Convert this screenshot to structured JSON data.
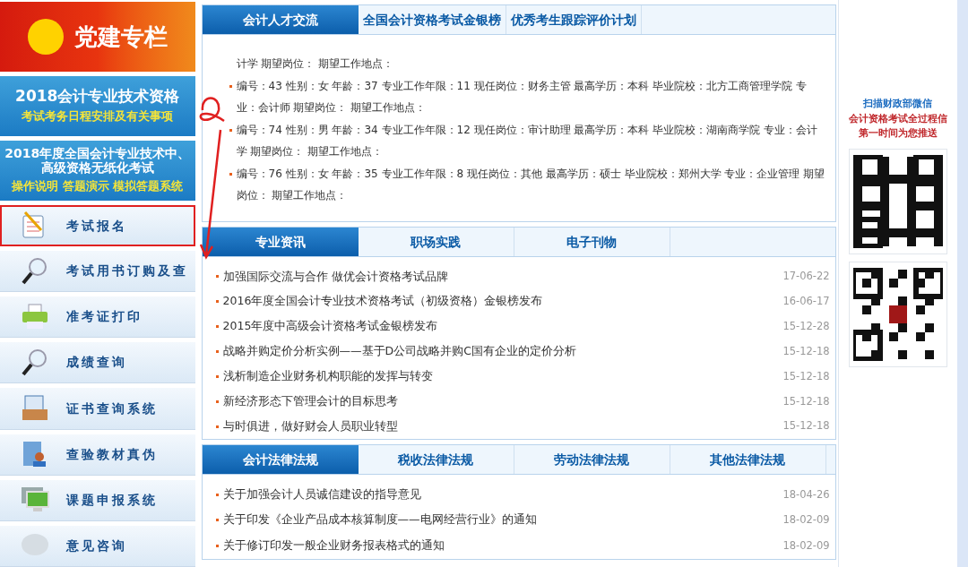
{
  "banners": [
    {
      "title": "党建专栏"
    },
    {
      "title": "2018会计专业技术资格",
      "subtitle": "考试考务日程安排及有关事项"
    },
    {
      "title": "2018年度全国会计专业技术中、高级资格无纸化考试",
      "subtitle": "操作说明 答题演示 模拟答题系统"
    }
  ],
  "menu": [
    {
      "label": "考试报名",
      "highlighted": true
    },
    {
      "label": "考试用书订购及查",
      "highlighted": false
    },
    {
      "label": "准考证打印",
      "highlighted": false
    },
    {
      "label": "成绩查询",
      "highlighted": false
    },
    {
      "label": "证书查询系统",
      "highlighted": false
    },
    {
      "label": "查验教材真伪",
      "highlighted": false
    },
    {
      "label": "课题申报系统",
      "highlighted": false
    },
    {
      "label": "意见咨询",
      "highlighted": false
    }
  ],
  "panels": [
    {
      "tabs": [
        {
          "label": "会计人才交流",
          "selected": true
        },
        {
          "label": "全国会计资格考试金银榜",
          "selected": false
        },
        {
          "label": "优秀考生跟踪评价计划",
          "selected": false
        }
      ],
      "kind": "text",
      "lines": [
        {
          "text": "计学 期望岗位： 期望工作地点：",
          "bullet": false
        },
        {
          "text": "编号：43 性别：女 年龄：37 专业工作年限：11 现任岗位：财务主管 最高学历：本科 毕业院校：北方工商管理学院 专业：会计师 期望岗位： 期望工作地点：",
          "bullet": true
        },
        {
          "text": "编号：74 性别：男 年龄：34 专业工作年限：12 现任岗位：审计助理 最高学历：本科 毕业院校：湖南商学院 专业：会计学 期望岗位： 期望工作地点：",
          "bullet": true
        },
        {
          "text": "编号：76 性别：女 年龄：35 专业工作年限：8 现任岗位：其他 最高学历：硕士 毕业院校：郑州大学 专业：企业管理 期望岗位： 期望工作地点：",
          "bullet": true
        }
      ]
    },
    {
      "tabs": [
        {
          "label": "专业资讯",
          "selected": true
        },
        {
          "label": "职场实践",
          "selected": false
        },
        {
          "label": "电子刊物",
          "selected": false
        }
      ],
      "kind": "list",
      "items": [
        {
          "title": "加强国际交流与合作 做优会计资格考试品牌",
          "date": "17-06-22"
        },
        {
          "title": "2016年度全国会计专业技术资格考试（初级资格）金银榜发布",
          "date": "16-06-17"
        },
        {
          "title": "2015年度中高级会计资格考试金银榜发布",
          "date": "15-12-28"
        },
        {
          "title": "战略并购定价分析实例——基于D公司战略并购C国有企业的定价分析",
          "date": "15-12-18"
        },
        {
          "title": "浅析制造企业财务机构职能的发挥与转变",
          "date": "15-12-18"
        },
        {
          "title": "新经济形态下管理会计的目标思考",
          "date": "15-12-18"
        },
        {
          "title": "与时俱进，做好财会人员职业转型",
          "date": "15-12-18"
        }
      ]
    },
    {
      "tabs": [
        {
          "label": "会计法律法规",
          "selected": true
        },
        {
          "label": "税收法律法规",
          "selected": false
        },
        {
          "label": "劳动法律法规",
          "selected": false
        },
        {
          "label": "其他法律法规",
          "selected": false
        }
      ],
      "kind": "list",
      "items": [
        {
          "title": "关于加强会计人员诚信建设的指导意见",
          "date": "18-04-26"
        },
        {
          "title": "关于印发《企业产品成本核算制度——电网经营行业》的通知",
          "date": "18-02-09"
        },
        {
          "title": "关于修订印发一般企业财务报表格式的通知",
          "date": "18-02-09"
        }
      ]
    }
  ],
  "sidebar_right": {
    "heading": "扫描财政部微信",
    "text_1": "会计资格考试全过程信",
    "text_2": "第一时间为您推送"
  }
}
